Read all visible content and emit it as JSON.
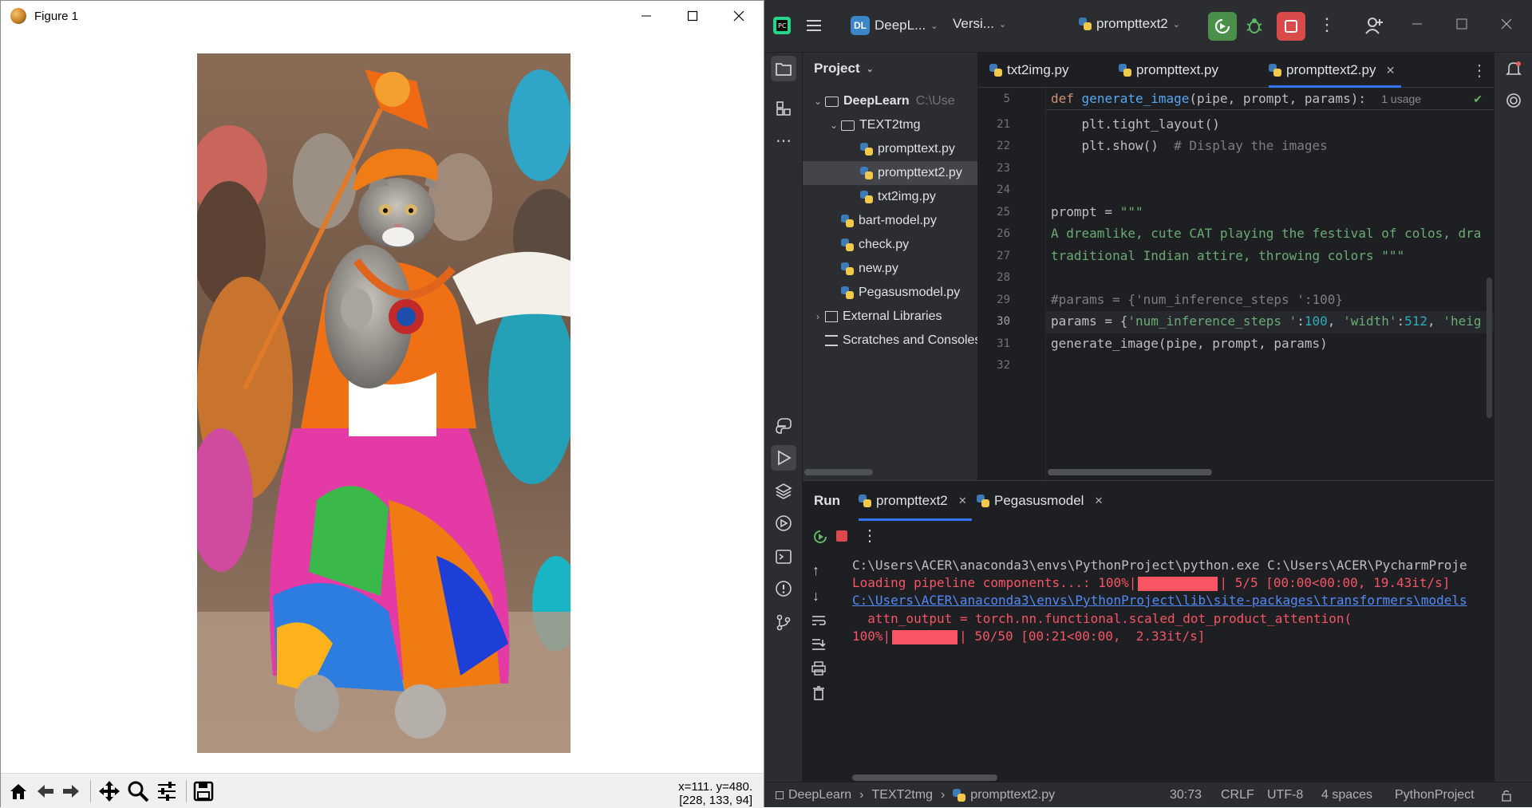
{
  "figure_window": {
    "title": "Figure 1",
    "image_alt": "Cat in traditional Indian attire dancing at a colorful festival",
    "coords_line1": "x=111. y=480.",
    "coords_line2": "[228, 133, 94]"
  },
  "ide": {
    "project_badge": "DL",
    "project_name": "DeepL...",
    "vcs_label": "Versi...",
    "run_config": "prompttext2",
    "project_panel": {
      "title": "Project",
      "root_name": "DeepLearn",
      "root_path": "C:\\Use",
      "folder_text2img": "TEXT2tmg",
      "files_in_folder": [
        "prompttext.py",
        "prompttext2.py",
        "txt2img.py"
      ],
      "files_root": [
        "bart-model.py",
        "check.py",
        "new.py",
        "Pegasusmodel.py"
      ],
      "external_libraries": "External Libraries",
      "scratches": "Scratches and Consoles"
    },
    "editor_tabs": [
      "txt2img.py",
      "prompttext.py",
      "prompttext2.py"
    ],
    "sticky": {
      "line": "5",
      "def_kw": "def",
      "fn_name": "generate_image",
      "args": "(pipe, prompt, params):",
      "usage_hint": "1 usage"
    },
    "line_numbers": [
      "21",
      "22",
      "23",
      "24",
      "25",
      "26",
      "27",
      "28",
      "29",
      "30",
      "31",
      "32"
    ],
    "code": {
      "l21": "    plt.tight_layout()",
      "l22_code": "    plt.show()  ",
      "l22_comment": "# Display the images",
      "l25_code": "prompt = ",
      "l25_str": "\"\"\"",
      "l26": "A dreamlike, cute CAT playing the festival of colos, dra",
      "l27": "traditional Indian attire, throwing colors \"\"\"",
      "l29": "#params = {'num_inference_steps ':100}",
      "l30_a": "params = {",
      "l30_b": "'num_inference_steps '",
      "l30_c": ":",
      "l30_d": "100",
      "l30_e": ", ",
      "l30_f": "'width'",
      "l30_g": ":",
      "l30_h": "512",
      "l30_i": ", ",
      "l30_j": "'heig",
      "l31": "generate_image(pipe, prompt, params)"
    },
    "run_panel": {
      "title": "Run",
      "tabs": [
        "prompttext2",
        "Pegasusmodel"
      ],
      "lines": {
        "cmd": "C:\\Users\\ACER\\anaconda3\\envs\\PythonProject\\python.exe C:\\Users\\ACER\\PycharmProje",
        "load_a": "Loading pipeline components...: 100%|",
        "load_b": "| 5/5 [00:00<00:00, 19.43it/s]",
        "link": "C:\\Users\\ACER\\anaconda3\\envs\\PythonProject\\lib\\site-packages\\transformers\\models",
        "attn": "  attn_output = torch.nn.functional.scaled_dot_product_attention(",
        "prog_a": "100%|",
        "prog_b": "| 50/50 [00:21<00:00,  2.33it/s]"
      }
    },
    "status": {
      "crumb1": "DeepLearn",
      "crumb2": "TEXT2tmg",
      "crumb3": "prompttext2.py",
      "position": "30:73",
      "line_sep": "CRLF",
      "encoding": "UTF-8",
      "indent": "4 spaces",
      "interpreter": "PythonProject"
    }
  },
  "colors": {
    "ide_bg": "#1e1f22",
    "panel_bg": "#2b2d30",
    "error_red": "#f75464",
    "run_green": "#4caf50",
    "stop_red": "#e24b4b",
    "accent_blue": "#3574f0"
  }
}
